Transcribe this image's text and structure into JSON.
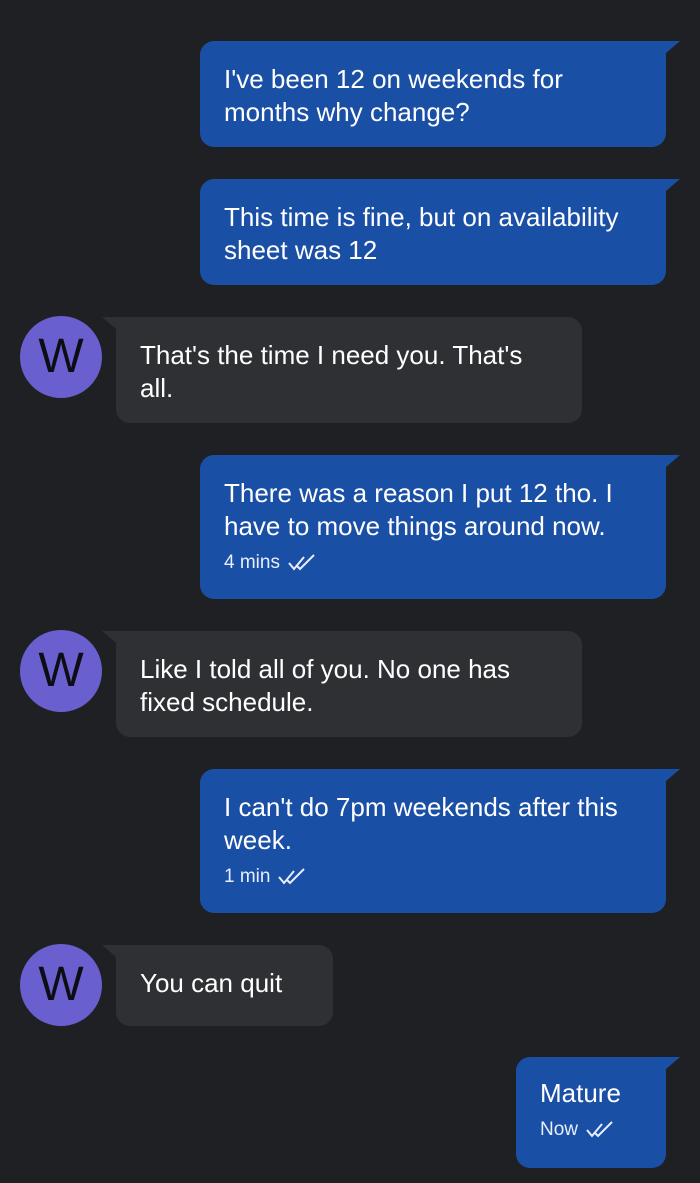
{
  "avatar": {
    "letter": "W",
    "color": "#6a5fcf"
  },
  "colors": {
    "outgoing": "#1a4fa6",
    "incoming": "#2f3034",
    "background": "#1f2023"
  },
  "messages": [
    {
      "direction": "out",
      "text": "I've been 12 on weekends for months why change?"
    },
    {
      "direction": "out",
      "text": "This time is fine, but on availability sheet was 12"
    },
    {
      "direction": "in",
      "text": "That's the time I need you. That's all."
    },
    {
      "direction": "out",
      "text": "There was a reason I put 12 tho. I have to move things around now.",
      "time": "4 mins",
      "status_icon": "double-check-icon"
    },
    {
      "direction": "in",
      "text": "Like I told all of you. No one has fixed schedule."
    },
    {
      "direction": "out",
      "text": "I can't do 7pm weekends after this week.",
      "time": "1 min",
      "status_icon": "double-check-icon"
    },
    {
      "direction": "in",
      "text": "You can quit"
    },
    {
      "direction": "out",
      "text": "Mature",
      "time": "Now",
      "status_icon": "double-check-icon"
    }
  ]
}
